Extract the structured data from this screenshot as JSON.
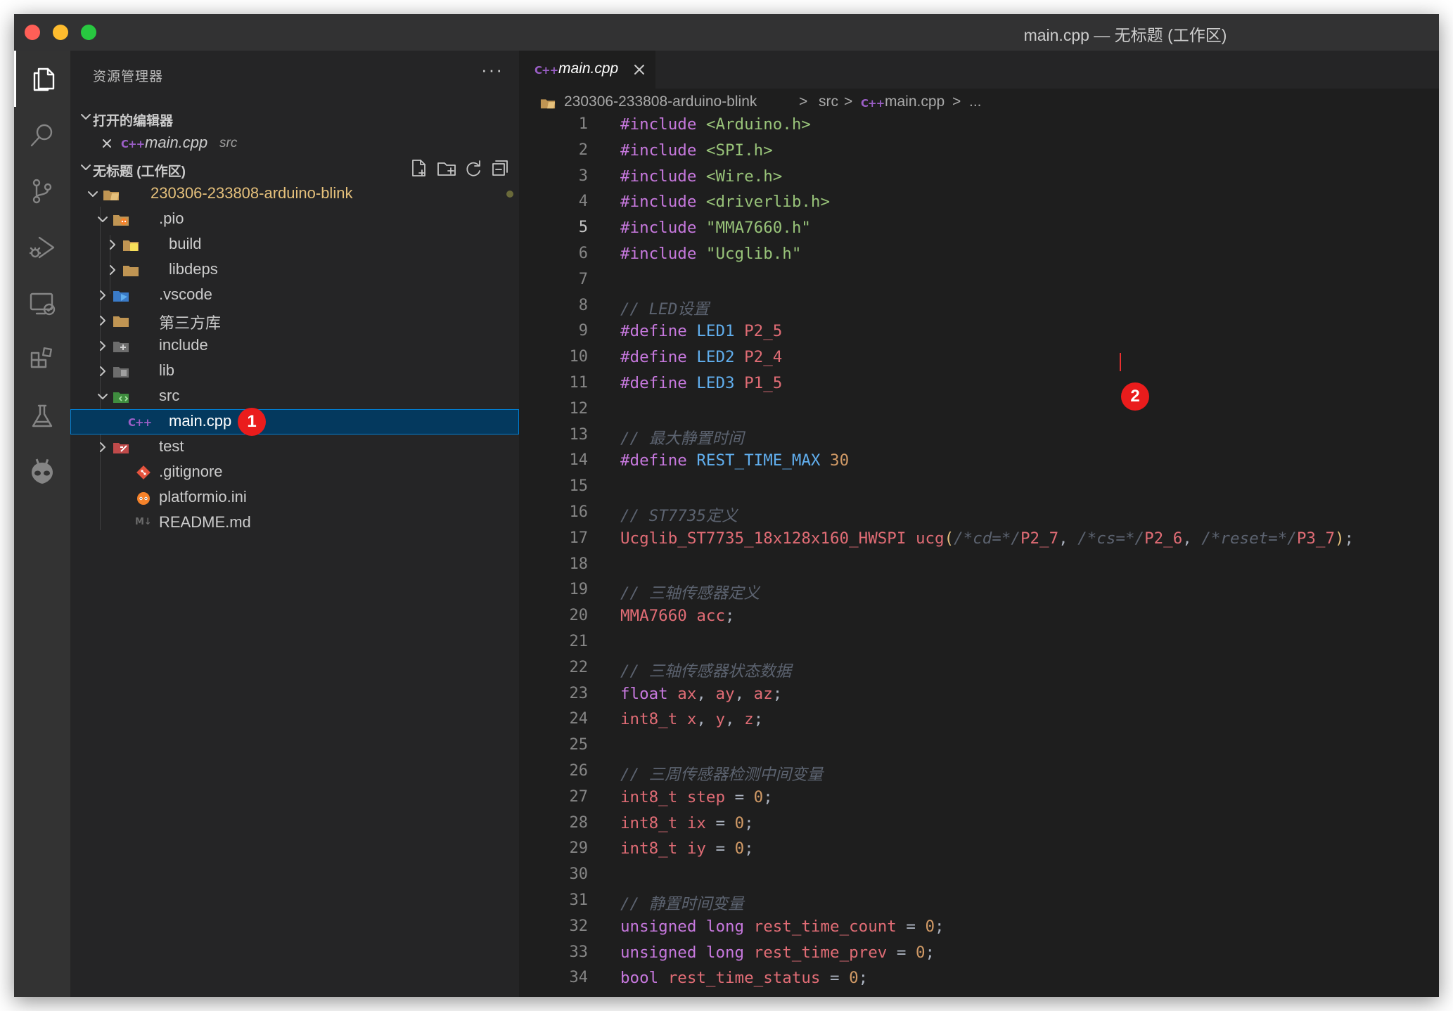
{
  "window": {
    "title": "main.cpp — 无标题 (工作区)"
  },
  "colors": {
    "accent": "#007fd4",
    "badge": "#ea1c1c",
    "selection": "#04395e",
    "folder_root": "#e5c07b"
  },
  "sidebar": {
    "title": "资源管理器",
    "more_icon": "ellipsis-icon",
    "open_editors": {
      "label": "打开的编辑器",
      "items": [
        {
          "icon": "cpp-file-icon",
          "icon_text": "C++",
          "name": "main.cpp",
          "path": "src"
        }
      ]
    },
    "workspace": {
      "label": "无标题 (工作区)",
      "toolbar_icons": [
        "new-file-icon",
        "new-folder-icon",
        "refresh-icon",
        "collapse-all-icon"
      ],
      "tree": [
        {
          "name": "230306-233808-arduino-blink",
          "icon": "folder-root-icon"
        },
        {
          "name": ".pio",
          "icon": "folder-pio-icon"
        },
        {
          "name": "build",
          "icon": "folder-build-icon"
        },
        {
          "name": "libdeps",
          "icon": "folder-icon"
        },
        {
          "name": ".vscode",
          "icon": "folder-vscode-icon"
        },
        {
          "name": "第三方库",
          "icon": "folder-icon"
        },
        {
          "name": "include",
          "icon": "folder-include-icon"
        },
        {
          "name": "lib",
          "icon": "folder-lib-icon"
        },
        {
          "name": "src",
          "icon": "folder-src-icon"
        },
        {
          "name": "main.cpp",
          "icon": "cpp-file-icon",
          "icon_text": "C++"
        },
        {
          "name": "test",
          "icon": "folder-test-icon"
        },
        {
          "name": ".gitignore",
          "icon": "git-icon"
        },
        {
          "name": "platformio.ini",
          "icon": "platformio-icon"
        },
        {
          "name": "README.md",
          "icon": "markdown-icon",
          "icon_text": "M↓"
        }
      ]
    }
  },
  "tabs": [
    {
      "label": "main.cpp",
      "icon": "cpp-file-icon",
      "icon_text": "C++"
    }
  ],
  "breadcrumb": {
    "items": [
      "230306-233808-arduino-blink",
      "src",
      "main.cpp",
      "..."
    ],
    "sep": ">"
  },
  "badges": {
    "one": "1",
    "two": "2"
  },
  "editor": {
    "current_line": 5,
    "lines": [
      [
        [
          "kw",
          "#include "
        ],
        [
          "str",
          "<Arduino.h>"
        ]
      ],
      [
        [
          "kw",
          "#include "
        ],
        [
          "str",
          "<SPI.h>"
        ]
      ],
      [
        [
          "kw",
          "#include "
        ],
        [
          "str",
          "<Wire.h>"
        ]
      ],
      [
        [
          "kw",
          "#include "
        ],
        [
          "str",
          "<driverlib.h>"
        ]
      ],
      [
        [
          "kw",
          "#include "
        ],
        [
          "str",
          "\"MMA7660.h\""
        ]
      ],
      [
        [
          "kw",
          "#include "
        ],
        [
          "str",
          "\"Ucglib.h\""
        ]
      ],
      [],
      [
        [
          "cm",
          "// LED设置"
        ]
      ],
      [
        [
          "kw",
          "#define "
        ],
        [
          "mac",
          "LED1 "
        ],
        [
          "ty",
          "P2_5"
        ]
      ],
      [
        [
          "kw",
          "#define "
        ],
        [
          "mac",
          "LED2 "
        ],
        [
          "ty",
          "P2_4"
        ]
      ],
      [
        [
          "kw",
          "#define "
        ],
        [
          "mac",
          "LED3 "
        ],
        [
          "ty",
          "P1_5"
        ]
      ],
      [],
      [
        [
          "cm",
          "// 最大静置时间"
        ]
      ],
      [
        [
          "kw",
          "#define "
        ],
        [
          "mac",
          "REST_TIME_MAX "
        ],
        [
          "num",
          "30"
        ]
      ],
      [],
      [
        [
          "cm",
          "// ST7735定义"
        ]
      ],
      [
        [
          "ty",
          "Ucglib_ST7735_18x128x160_HWSPI "
        ],
        [
          "ty",
          "ucg"
        ],
        [
          "par",
          "("
        ],
        [
          "cm",
          "/*cd=*/"
        ],
        [
          "ty",
          "P2_7"
        ],
        [
          "pl",
          ", "
        ],
        [
          "cm",
          "/*cs=*/"
        ],
        [
          "ty",
          "P2_6"
        ],
        [
          "pl",
          ", "
        ],
        [
          "cm",
          "/*reset=*/"
        ],
        [
          "ty",
          "P3_7"
        ],
        [
          "par",
          ")"
        ],
        [
          "pl",
          ";"
        ]
      ],
      [],
      [
        [
          "cm",
          "// 三轴传感器定义"
        ]
      ],
      [
        [
          "ty",
          "MMA7660 "
        ],
        [
          "ty",
          "acc"
        ],
        [
          "pl",
          ";"
        ]
      ],
      [],
      [
        [
          "cm",
          "// 三轴传感器状态数据"
        ]
      ],
      [
        [
          "kw",
          "float "
        ],
        [
          "ty",
          "ax"
        ],
        [
          "pl",
          ", "
        ],
        [
          "ty",
          "ay"
        ],
        [
          "pl",
          ", "
        ],
        [
          "ty",
          "az"
        ],
        [
          "pl",
          ";"
        ]
      ],
      [
        [
          "ty",
          "int8_t "
        ],
        [
          "ty",
          "x"
        ],
        [
          "pl",
          ", "
        ],
        [
          "ty",
          "y"
        ],
        [
          "pl",
          ", "
        ],
        [
          "ty",
          "z"
        ],
        [
          "pl",
          ";"
        ]
      ],
      [],
      [
        [
          "cm",
          "// 三周传感器检测中间变量"
        ]
      ],
      [
        [
          "ty",
          "int8_t "
        ],
        [
          "ty",
          "step "
        ],
        [
          "pl",
          "= "
        ],
        [
          "num",
          "0"
        ],
        [
          "pl",
          ";"
        ]
      ],
      [
        [
          "ty",
          "int8_t "
        ],
        [
          "ty",
          "ix "
        ],
        [
          "pl",
          "= "
        ],
        [
          "num",
          "0"
        ],
        [
          "pl",
          ";"
        ]
      ],
      [
        [
          "ty",
          "int8_t "
        ],
        [
          "ty",
          "iy "
        ],
        [
          "pl",
          "= "
        ],
        [
          "num",
          "0"
        ],
        [
          "pl",
          ";"
        ]
      ],
      [],
      [
        [
          "cm",
          "// 静置时间变量"
        ]
      ],
      [
        [
          "kw",
          "unsigned "
        ],
        [
          "kw",
          "long "
        ],
        [
          "ty",
          "rest_time_count "
        ],
        [
          "pl",
          "= "
        ],
        [
          "num",
          "0"
        ],
        [
          "pl",
          ";"
        ]
      ],
      [
        [
          "kw",
          "unsigned "
        ],
        [
          "kw",
          "long "
        ],
        [
          "ty",
          "rest_time_prev "
        ],
        [
          "pl",
          "= "
        ],
        [
          "num",
          "0"
        ],
        [
          "pl",
          ";"
        ]
      ],
      [
        [
          "kw",
          "bool "
        ],
        [
          "ty",
          "rest_time_status "
        ],
        [
          "pl",
          "= "
        ],
        [
          "num",
          "0"
        ],
        [
          "pl",
          ";"
        ]
      ]
    ]
  }
}
